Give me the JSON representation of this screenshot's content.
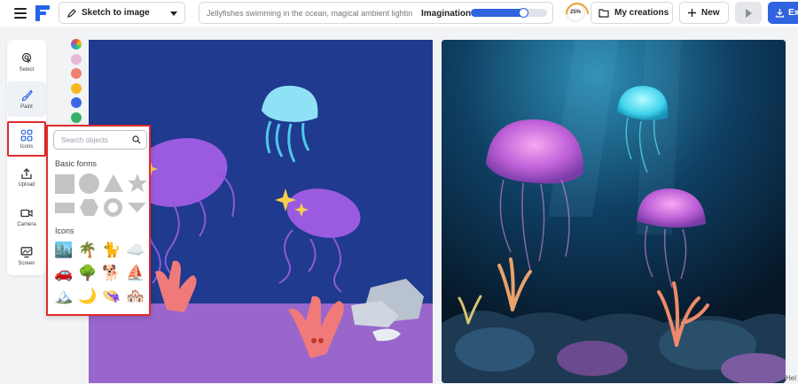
{
  "header": {
    "mode_label": "Sketch to image",
    "prompt_value": "Jellyfishes swimming in the ocean, magical ambient lighting",
    "imagination_label": "Imagination",
    "imagination_level": 0.7,
    "credits_label": "25%",
    "my_creations_label": "My creations",
    "new_label": "New",
    "export_label": "Ex"
  },
  "tools": [
    {
      "label": "Select",
      "icon": "select-icon"
    },
    {
      "label": "Paint",
      "icon": "brush-icon"
    },
    {
      "label": "Icons",
      "icon": "shapes-icon"
    },
    {
      "label": "Upload",
      "icon": "upload-icon"
    },
    {
      "label": "Camera",
      "icon": "camera-icon"
    },
    {
      "label": "Screen",
      "icon": "screen-icon"
    }
  ],
  "palette": [
    "#e8b8d8",
    "#f08070",
    "#f6b820",
    "#3a66e8",
    "#36b36a",
    "#111111"
  ],
  "icons_panel": {
    "search_placeholder": "Search objects",
    "basic_forms_label": "Basic forms",
    "icons_label": "Icons"
  },
  "footer": {
    "help_label": "Hel"
  },
  "colors": {
    "accent": "#2f63e0",
    "highlight": "#e02b2b",
    "canvas_bg": "#1f3a8f",
    "ground": "#9966cc"
  }
}
